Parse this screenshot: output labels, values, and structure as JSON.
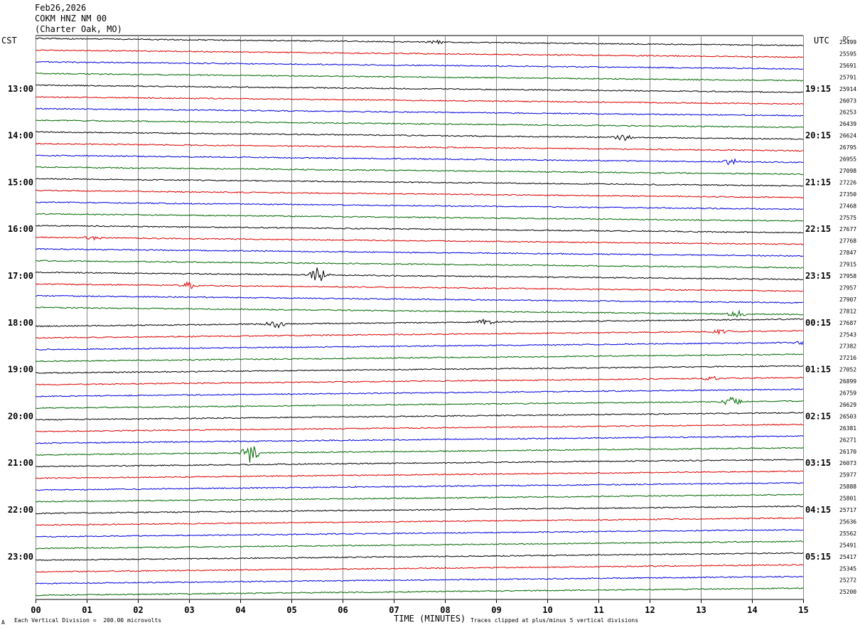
{
  "header": {
    "date": "Feb26,2026",
    "station": "COKM HNZ NM 00",
    "location": "(Charter Oak, MO)"
  },
  "left_axis_title": "CST",
  "right_axis_title": "UTC",
  "dc_title": "DC",
  "footer": {
    "scale_note": "Each Vertical Division =  200.00 microvolts",
    "clip_note": "Traces clipped at plus/minus 5 vertical divisions",
    "corner_mark": "A"
  },
  "colors": {
    "trace_cycle": [
      "#000000",
      "#dd0000",
      "#0000dd",
      "#006600"
    ],
    "grid": "#888888"
  },
  "chart_data": {
    "type": "line",
    "title": "",
    "xlabel": "TIME (MINUTES)",
    "xlim": [
      0,
      15
    ],
    "x_ticks": [
      "00",
      "01",
      "02",
      "03",
      "04",
      "05",
      "06",
      "07",
      "08",
      "09",
      "10",
      "11",
      "12",
      "13",
      "14",
      "15"
    ],
    "rows": 48,
    "minutes_per_row": 15,
    "left_time_labels": [
      {
        "row": 4,
        "text": "13:00"
      },
      {
        "row": 8,
        "text": "14:00"
      },
      {
        "row": 12,
        "text": "15:00"
      },
      {
        "row": 16,
        "text": "16:00"
      },
      {
        "row": 20,
        "text": "17:00"
      },
      {
        "row": 24,
        "text": "18:00"
      },
      {
        "row": 28,
        "text": "19:00"
      },
      {
        "row": 32,
        "text": "20:00"
      },
      {
        "row": 36,
        "text": "21:00"
      },
      {
        "row": 40,
        "text": "22:00"
      },
      {
        "row": 44,
        "text": "23:00"
      }
    ],
    "right_time_labels": [
      {
        "row": 4,
        "text": "19:15"
      },
      {
        "row": 8,
        "text": "20:15"
      },
      {
        "row": 12,
        "text": "21:15"
      },
      {
        "row": 16,
        "text": "22:15"
      },
      {
        "row": 20,
        "text": "23:15"
      },
      {
        "row": 24,
        "text": "00:15"
      },
      {
        "row": 28,
        "text": "01:15"
      },
      {
        "row": 32,
        "text": "02:15"
      },
      {
        "row": 36,
        "text": "03:15"
      },
      {
        "row": 40,
        "text": "04:15"
      },
      {
        "row": 44,
        "text": "05:15"
      }
    ],
    "dc_offsets": [
      "25499",
      "25595",
      "25691",
      "25791",
      "25914",
      "26073",
      "26253",
      "26439",
      "26624",
      "26795",
      "26955",
      "27098",
      "27226",
      "27350",
      "27468",
      "27575",
      "27677",
      "27768",
      "27847",
      "27915",
      "27958",
      "27957",
      "27907",
      "27812",
      "27687",
      "27543",
      "27382",
      "27216",
      "27052",
      "26899",
      "26759",
      "26629",
      "26503",
      "26381",
      "26271",
      "26170",
      "26073",
      "25977",
      "25888",
      "25801",
      "25717",
      "25636",
      "25562",
      "25491",
      "25417",
      "25345",
      "25272",
      "25200"
    ],
    "events": [
      {
        "row": 0,
        "minute": 7.85,
        "amplitude": 4
      },
      {
        "row": 8,
        "minute": 11.5,
        "amplitude": 5
      },
      {
        "row": 10,
        "minute": 13.6,
        "amplitude": 5
      },
      {
        "row": 17,
        "minute": 1.1,
        "amplitude": 4
      },
      {
        "row": 20,
        "minute": 5.55,
        "amplitude": 12
      },
      {
        "row": 21,
        "minute": 3.0,
        "amplitude": 5
      },
      {
        "row": 23,
        "minute": 13.7,
        "amplitude": 5
      },
      {
        "row": 24,
        "minute": 4.7,
        "amplitude": 7
      },
      {
        "row": 24,
        "minute": 8.8,
        "amplitude": 5
      },
      {
        "row": 25,
        "minute": 13.4,
        "amplitude": 4
      },
      {
        "row": 26,
        "minute": 15.0,
        "amplitude": 4
      },
      {
        "row": 29,
        "minute": 13.2,
        "amplitude": 4
      },
      {
        "row": 31,
        "minute": 13.6,
        "amplitude": 7
      },
      {
        "row": 35,
        "minute": 4.2,
        "amplitude": 14
      }
    ]
  }
}
